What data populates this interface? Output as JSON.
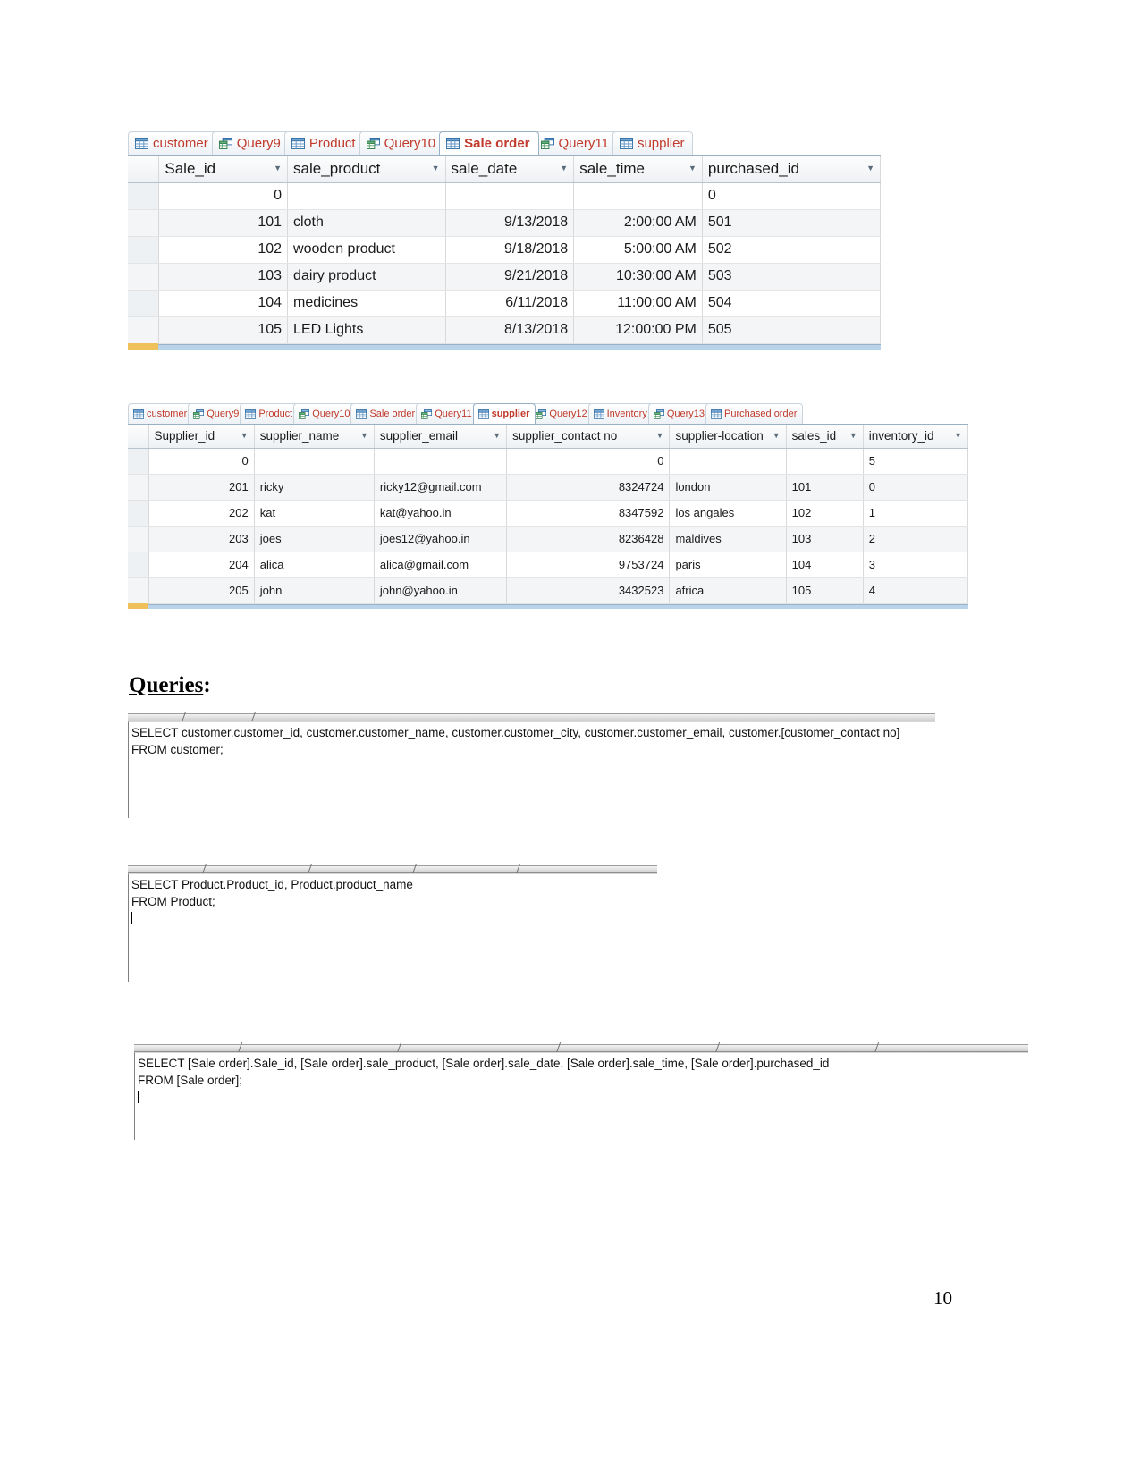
{
  "document": {
    "page_number": "10",
    "queries_heading": "Queries",
    "queries_heading_suffix": ":"
  },
  "sale_order_view": {
    "tabs": [
      {
        "label": "customer",
        "icon": "table-icon",
        "active": false
      },
      {
        "label": "Query9",
        "icon": "query-icon",
        "active": false
      },
      {
        "label": "Product",
        "icon": "table-icon",
        "active": false
      },
      {
        "label": "Query10",
        "icon": "query-icon",
        "active": false
      },
      {
        "label": "Sale order",
        "icon": "table-icon",
        "active": true
      },
      {
        "label": "Query11",
        "icon": "query-icon",
        "active": false
      },
      {
        "label": "supplier",
        "icon": "table-icon",
        "active": false
      }
    ],
    "columns": [
      "Sale_id",
      "sale_product",
      "sale_date",
      "sale_time",
      "purchased_id"
    ],
    "rows": [
      {
        "Sale_id": "0",
        "sale_product": "",
        "sale_date": "",
        "sale_time": "",
        "purchased_id": "0"
      },
      {
        "Sale_id": "101",
        "sale_product": "cloth",
        "sale_date": "9/13/2018",
        "sale_time": "2:00:00 AM",
        "purchased_id": "501"
      },
      {
        "Sale_id": "102",
        "sale_product": "wooden product",
        "sale_date": "9/18/2018",
        "sale_time": "5:00:00 AM",
        "purchased_id": "502"
      },
      {
        "Sale_id": "103",
        "sale_product": "dairy product",
        "sale_date": "9/21/2018",
        "sale_time": "10:30:00 AM",
        "purchased_id": "503"
      },
      {
        "Sale_id": "104",
        "sale_product": "medicines",
        "sale_date": "6/11/2018",
        "sale_time": "11:00:00 AM",
        "purchased_id": "504"
      },
      {
        "Sale_id": "105",
        "sale_product": "LED Lights",
        "sale_date": "8/13/2018",
        "sale_time": "12:00:00 PM",
        "purchased_id": "505"
      }
    ]
  },
  "supplier_view": {
    "tabs": [
      {
        "label": "customer",
        "icon": "table-icon",
        "active": false
      },
      {
        "label": "Query9",
        "icon": "query-icon",
        "active": false
      },
      {
        "label": "Product",
        "icon": "table-icon",
        "active": false
      },
      {
        "label": "Query10",
        "icon": "query-icon",
        "active": false
      },
      {
        "label": "Sale order",
        "icon": "table-icon",
        "active": false
      },
      {
        "label": "Query11",
        "icon": "query-icon",
        "active": false
      },
      {
        "label": "supplier",
        "icon": "table-icon",
        "active": true
      },
      {
        "label": "Query12",
        "icon": "query-icon",
        "active": false
      },
      {
        "label": "Inventory",
        "icon": "table-icon",
        "active": false
      },
      {
        "label": "Query13",
        "icon": "query-icon",
        "active": false
      },
      {
        "label": "Purchased order",
        "icon": "table-icon",
        "active": false
      }
    ],
    "columns": [
      "Supplier_id",
      "supplier_name",
      "supplier_email",
      "supplier_contact no",
      "supplier-location",
      "sales_id",
      "inventory_id"
    ],
    "rows": [
      {
        "Supplier_id": "0",
        "supplier_name": "",
        "supplier_email": "",
        "supplier_contact no": "0",
        "supplier-location": "",
        "sales_id": "",
        "inventory_id": "5"
      },
      {
        "Supplier_id": "201",
        "supplier_name": "ricky",
        "supplier_email": "ricky12@gmail.com",
        "supplier_contact no": "8324724",
        "supplier-location": "london",
        "sales_id": "101",
        "inventory_id": "0"
      },
      {
        "Supplier_id": "202",
        "supplier_name": "kat",
        "supplier_email": "kat@yahoo.in",
        "supplier_contact no": "8347592",
        "supplier-location": "los angales",
        "sales_id": "102",
        "inventory_id": "1"
      },
      {
        "Supplier_id": "203",
        "supplier_name": "joes",
        "supplier_email": "joes12@yahoo.in",
        "supplier_contact no": "8236428",
        "supplier-location": "maldives",
        "sales_id": "103",
        "inventory_id": "2"
      },
      {
        "Supplier_id": "204",
        "supplier_name": "alica",
        "supplier_email": "alica@gmail.com",
        "supplier_contact no": "9753724",
        "supplier-location": "paris",
        "sales_id": "104",
        "inventory_id": "3"
      },
      {
        "Supplier_id": "205",
        "supplier_name": "john",
        "supplier_email": "john@yahoo.in",
        "supplier_contact no": "3432523",
        "supplier-location": "africa",
        "sales_id": "105",
        "inventory_id": "4"
      }
    ]
  },
  "sql_blocks": [
    {
      "name": "customer-query",
      "line1": "SELECT customer.customer_id, customer.customer_name, customer.customer_city, customer.customer_email, customer.[customer_contact no]",
      "line2": "FROM customer;"
    },
    {
      "name": "product-query",
      "line1": "SELECT Product.Product_id, Product.product_name",
      "line2": "FROM Product;"
    },
    {
      "name": "sale-order-query",
      "line1": "SELECT [Sale order].Sale_id, [Sale order].sale_product, [Sale order].sale_date, [Sale order].sale_time, [Sale order].purchased_id",
      "line2": "FROM [Sale order];"
    }
  ],
  "colors": {
    "tab_text": "#c0392b",
    "grid_line": "#d9d9d9",
    "alt_row": "#f4f5f7",
    "selected_bar": "#b9d3ea"
  }
}
